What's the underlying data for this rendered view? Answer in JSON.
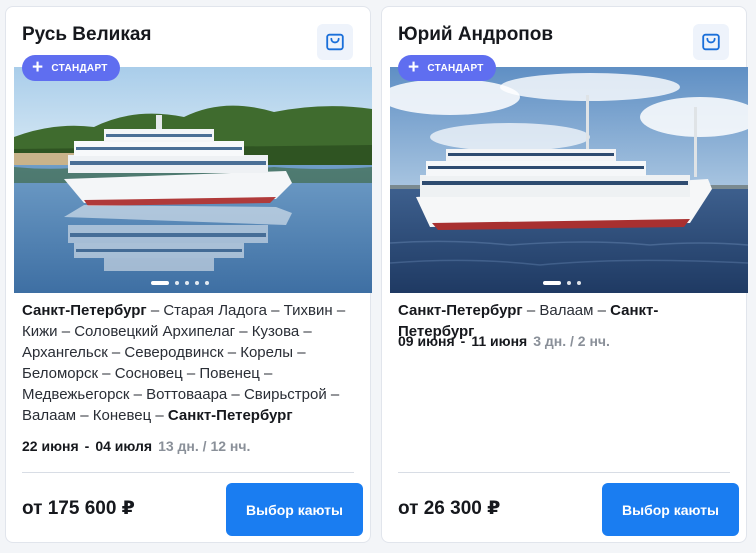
{
  "cards": [
    {
      "title": "Русь Великая",
      "badge": "СТАНДАРТ",
      "route": [
        {
          "text": "Санкт-Петербург",
          "bold": true
        },
        {
          "text": " – Старая Ладога – Тихвин – Кижи – Соловецкий Архипелаг – Кузова – Архангельск – Северодвинск – Корелы – Беломорск – Сосновец – Повенец – Медвежьегорск – Воттоваара – Свирьстрой – Валаам – Коневец – ",
          "bold": false
        },
        {
          "text": "Санкт-Петербург",
          "bold": true
        }
      ],
      "date_from": "22 июня",
      "date_sep": "-",
      "date_to": "04 июля",
      "duration": "13 дн. / 12 нч.",
      "price": "от 175 600 ₽",
      "button": "Выбор каюты",
      "slides": 5,
      "active_slide": 0
    },
    {
      "title": "Юрий Андропов",
      "badge": "СТАНДАРТ",
      "route": [
        {
          "text": "Санкт-Петербург",
          "bold": true
        },
        {
          "text": " – Валаам – ",
          "bold": false
        },
        {
          "text": "Санкт-Петербург",
          "bold": true
        }
      ],
      "date_from": "09 июня",
      "date_sep": "-",
      "date_to": "11 июня",
      "duration": "3 дн. / 2 нч.",
      "price": "от 26 300 ₽",
      "button": "Выбор каюты",
      "slides": 3,
      "active_slide": 0
    }
  ],
  "colors": {
    "badge": "#5f6ef0",
    "button": "#1a7df1",
    "cart_icon": "#1a6fd9",
    "muted": "#8a9099"
  },
  "icons": {
    "cart": "shopping-bag-icon",
    "badge": "plus-icon"
  }
}
